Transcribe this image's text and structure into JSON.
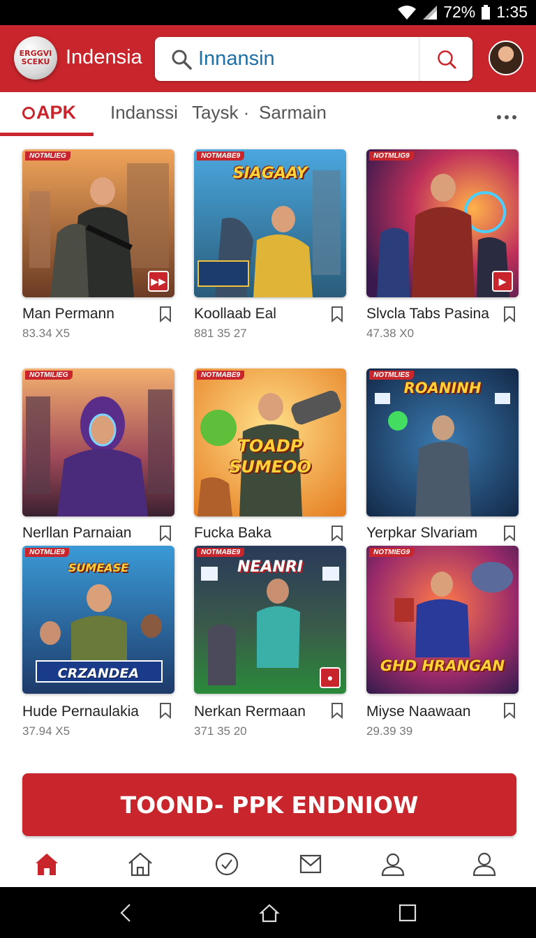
{
  "status": {
    "battery": "72%",
    "time": "1:35"
  },
  "header": {
    "logo_line1": "ERGGVI",
    "logo_line2": "SCEKU",
    "brand": "Indensia",
    "search_value": "Innansin"
  },
  "tabs": [
    {
      "label": "APK"
    },
    {
      "label": "Indanssi"
    },
    {
      "label": "Taysk ·"
    },
    {
      "label": "Sarmain"
    }
  ],
  "games": [
    {
      "tag": "NOTMLIEG",
      "title": "Man Permann",
      "meta": "83.34 X5",
      "banner": ""
    },
    {
      "tag": "NOTMABE9",
      "title": "Koollaab Eal",
      "meta": "881 35 27",
      "banner": "SIAGAAY"
    },
    {
      "tag": "NOTMLIG9",
      "title": "Slvcla Tabs Pasina",
      "meta": "47.38 X0",
      "banner": ""
    },
    {
      "tag": "NOTMILIEG",
      "title": "Nerllan Parnaian",
      "meta": "",
      "banner": ""
    },
    {
      "tag": "NOTMABE9",
      "title": "Fucka Baka",
      "meta": "",
      "banner": "TOADP SUMEOO"
    },
    {
      "tag": "NOTMLIES",
      "title": "Yerpkar Slvariam",
      "meta": "",
      "banner": "ROANINH"
    },
    {
      "tag": "NOTMLIE9",
      "title": "Hude Pernaulakia",
      "meta": "37.94 X5",
      "banner": "CRZANDEA"
    },
    {
      "tag": "NOTMABE9",
      "title": "Nerkan Rermaan",
      "meta": "371 35 20",
      "banner": "NEANRI"
    },
    {
      "tag": "NOTMIEG9",
      "title": "Miyse Naawaan",
      "meta": "29.39 39",
      "banner": "GHD HRANGAN"
    }
  ],
  "cta": {
    "label": "TOOND- PPK ENDNIOW"
  },
  "colors": {
    "accent": "#c8262c",
    "status_bar": "#000000"
  },
  "nav_icons": [
    "home-filled-icon",
    "home-outline-icon",
    "check-circle-icon",
    "mail-icon",
    "profile-icon",
    "account-icon"
  ]
}
